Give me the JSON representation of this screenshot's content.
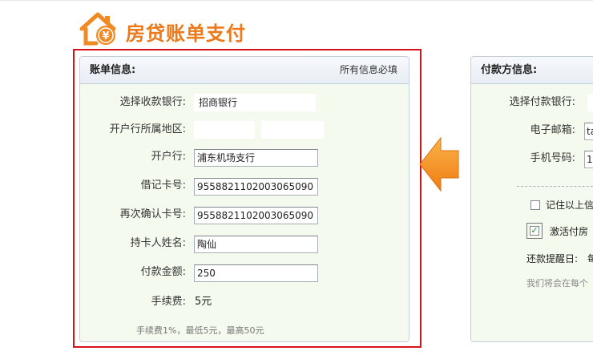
{
  "header": {
    "title": "房贷账单支付"
  },
  "bill_panel": {
    "title": "账单信息:",
    "note": "所有信息必填",
    "fields": {
      "receiving_bank": {
        "label": "选择收款银行:",
        "value": "招商银行"
      },
      "region": {
        "label": "开户行所属地区:"
      },
      "branch": {
        "label": "开户行:",
        "value": "浦东机场支行"
      },
      "debit_card": {
        "label": "借记卡号:",
        "value": "9558821102003065090"
      },
      "confirm_card": {
        "label": "再次确认卡号:",
        "value": "9558821102003065090"
      },
      "holder_name": {
        "label": "持卡人姓名:",
        "value": "陶仙"
      },
      "amount": {
        "label": "付款金额:",
        "value": "250"
      },
      "fee": {
        "label": "手续费:",
        "value": "5元"
      }
    },
    "fee_note": "手续费1%，最低5元，最高50元"
  },
  "payer_panel": {
    "title": "付款方信息:",
    "pay_bank_label": "选择付款银行:",
    "email_label": "电子邮箱:",
    "email_value": "ta",
    "phone_label": "手机号码:",
    "phone_value": "1",
    "remember_label": "记住以上信",
    "activate_label": "激活付房",
    "reminder_label": "还款提醒日:",
    "reminder_value": "每",
    "footer_text": "我们将会在每个"
  },
  "colors": {
    "accent": "#ec7a1c",
    "highlight_border": "#d7121b",
    "panel_bg": "#f5faee"
  }
}
